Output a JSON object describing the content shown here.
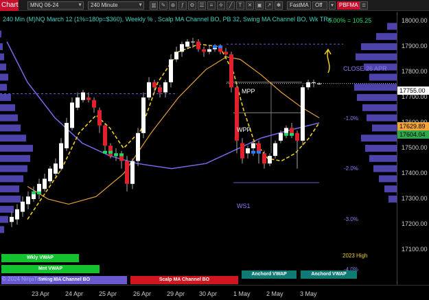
{
  "toolbar": {
    "tab": "Chart",
    "instrument": "MNQ 06-24",
    "interval": "240 Minute",
    "indicator": "FastMA",
    "toggle": "Off",
    "pb_button": "PBFMA"
  },
  "info": {
    "line": "240 Min (M)NQ March 12 (1%=180p=$360), Weekly % , Scalp MA Channel BO, PB 32, Swing MA Channel BO, Wk TRx:",
    "right": "0.00% = 105.25"
  },
  "y_axis": {
    "ticks": [
      "18000.00",
      "17900.00",
      "17800.00",
      "17700.00",
      "17600.00",
      "17500.00",
      "17400.00",
      "17300.00",
      "17200.00",
      "17100.00"
    ],
    "tick_values": [
      18000,
      17900,
      17800,
      17700,
      17600,
      17500,
      17400,
      17300,
      17200,
      17100
    ],
    "current_price": "17755.00",
    "tag_orange": "17629.89",
    "tag_green": "17604.04",
    "color_orange": "#f2a33a",
    "color_green": "#2ea84b"
  },
  "x_axis": {
    "labels": [
      "23 Apr",
      "24 Apr",
      "25 Apr",
      "26 Apr",
      "29 Apr",
      "30 Apr",
      "1 May",
      "2 May",
      "3 May"
    ]
  },
  "annotations": {
    "close": "CLOSE 26 APR",
    "mpp": "MPP",
    "wpp": "WPP",
    "ws1": "WS1",
    "pct1": "-1.0%",
    "pct2": "-2.0%",
    "pct3": "-3.0%",
    "pct4": "-4.0%",
    "high2023": "2023 High",
    "copyright": "© 2024 NinjaTrader, LLC"
  },
  "buttons": {
    "wkly_vwap": "Wkly VWAP",
    "mnt_vwap": "Mnt VWAP",
    "swing": "Swing MA Channel BO",
    "scalp": "Scalp MA Channel BO",
    "anchord1": "Anchord VWAP",
    "anchord2": "Anchord VWAP"
  },
  "colors": {
    "up_candle": "#ffffff",
    "down_candle": "#e0202a",
    "fast_ma": "#f0d020",
    "orange_ma": "#e6a23c",
    "purple_ma": "#7b68ee",
    "profile": "#6a5acd"
  }
}
